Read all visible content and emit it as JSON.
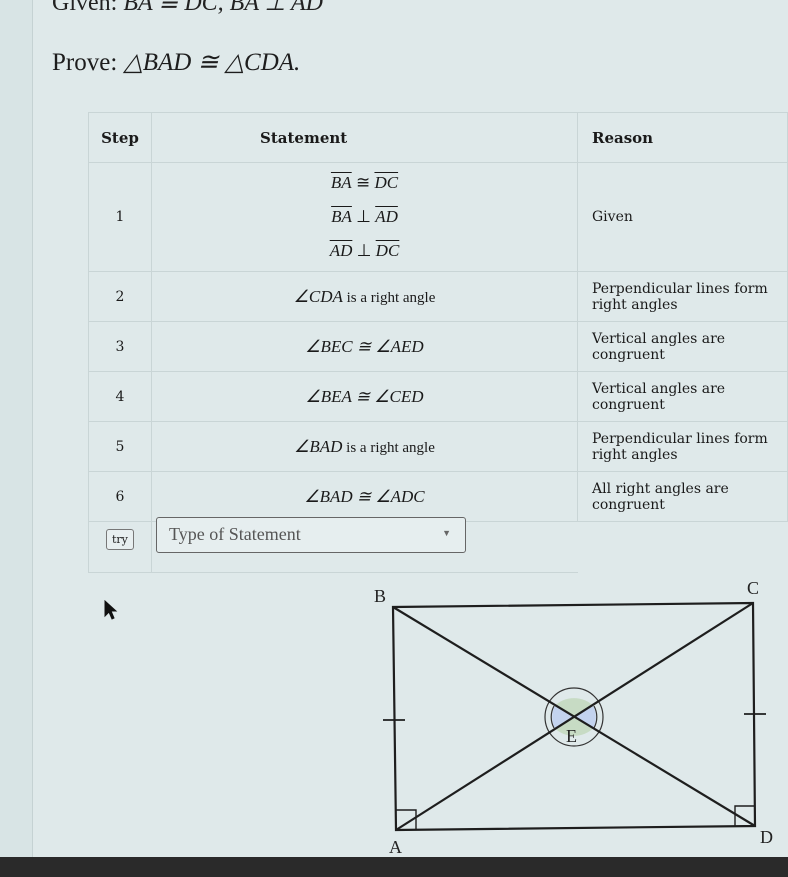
{
  "given": {
    "label": "Given:",
    "text": "BA ≅ DC, BA ⊥ AD"
  },
  "prove": {
    "label": "Prove:",
    "statement": "△BAD ≅ △CDA."
  },
  "table": {
    "headers": {
      "step": "Step",
      "statement": "Statement",
      "reason": "Reason"
    },
    "rows": [
      {
        "step": "1",
        "statements": [
          "BA ≅ DC",
          "BA ⊥ AD",
          "AD ⊥ DC"
        ],
        "reason": "Given"
      },
      {
        "step": "2",
        "statement_math": "∠CDA",
        "statement_text": " is a right angle",
        "reason": "Perpendicular lines form right angles"
      },
      {
        "step": "3",
        "statement_math": "∠BEC ≅ ∠AED",
        "statement_text": "",
        "reason": "Vertical angles are congruent"
      },
      {
        "step": "4",
        "statement_math": "∠BEA ≅ ∠CED",
        "statement_text": "",
        "reason": "Vertical angles are congruent"
      },
      {
        "step": "5",
        "statement_math": "∠BAD",
        "statement_text": " is a right angle",
        "reason": "Perpendicular lines form right angles"
      },
      {
        "step": "6",
        "statement_math": "∠BAD ≅ ∠ADC",
        "statement_text": "",
        "reason": "All right angles are congruent"
      }
    ]
  },
  "input_row": {
    "try_label": "try",
    "select_placeholder": "Type of Statement",
    "caret_icon": "caret-down-icon"
  },
  "diagram": {
    "labels": {
      "A": "A",
      "B": "B",
      "C": "C",
      "D": "D",
      "E": "E"
    },
    "colors": {
      "vertical_angle_fill": "#c7dbc4",
      "side_angle_fill": "#c3d3ee",
      "stroke": "#1e1e1e"
    }
  }
}
